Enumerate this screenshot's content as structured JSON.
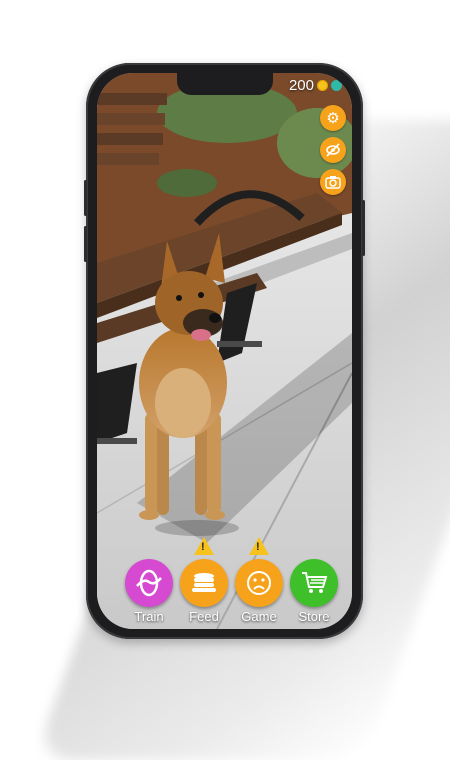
{
  "status": {
    "coins": "200"
  },
  "colors": {
    "train": "#d64ad1",
    "feed": "#f7a21b",
    "game": "#f7a21b",
    "store": "#3fbf2a",
    "hud_icon": "#f7a21b",
    "warning": "#f7c21c"
  },
  "top_icons": [
    "gear-icon",
    "eye-off-icon",
    "camera-icon"
  ],
  "actions": [
    {
      "label": "Train",
      "icon": "training-hoop-icon",
      "warning": false
    },
    {
      "label": "Feed",
      "icon": "pancakes-icon",
      "warning": true
    },
    {
      "label": "Game",
      "icon": "sad-face-icon",
      "warning": true
    },
    {
      "label": "Store",
      "icon": "shopping-cart-icon",
      "warning": false
    }
  ]
}
